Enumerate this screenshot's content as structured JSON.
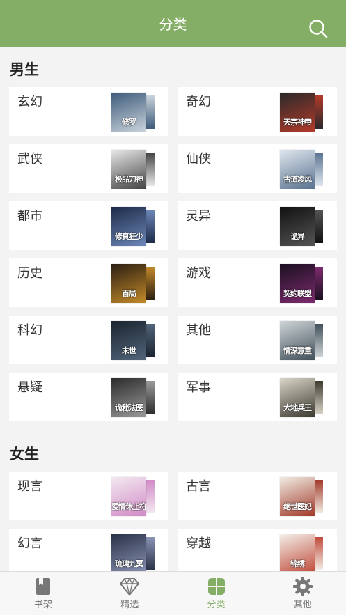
{
  "header": {
    "title": "分类",
    "search_icon": "search-icon"
  },
  "sections": [
    {
      "title": "男生",
      "items": [
        {
          "label": "玄幻",
          "cover_text": "修罗",
          "colors": [
            "#3e5b7a",
            "#c9d3dc"
          ]
        },
        {
          "label": "奇幻",
          "cover_text": "天宗神帝",
          "colors": [
            "#2a2a2a",
            "#b33a2a"
          ]
        },
        {
          "label": "武侠",
          "cover_text": "极品刀神",
          "colors": [
            "#e8e8e8",
            "#444444"
          ]
        },
        {
          "label": "仙侠",
          "cover_text": "古道凌风",
          "colors": [
            "#dfe6ee",
            "#5a7390"
          ]
        },
        {
          "label": "都市",
          "cover_text": "修真狂少",
          "colors": [
            "#1d2b48",
            "#6d87b8"
          ]
        },
        {
          "label": "灵异",
          "cover_text": "诡异",
          "colors": [
            "#111111",
            "#555555"
          ]
        },
        {
          "label": "历史",
          "cover_text": "百局",
          "colors": [
            "#2b1f12",
            "#c48a2a"
          ]
        },
        {
          "label": "游戏",
          "cover_text": "契约联盟",
          "colors": [
            "#1a1020",
            "#7d2b6e"
          ]
        },
        {
          "label": "科幻",
          "cover_text": "末世",
          "colors": [
            "#1b2430",
            "#52657a"
          ]
        },
        {
          "label": "其他",
          "cover_text": "情深意重",
          "colors": [
            "#cfd5d8",
            "#42505a"
          ]
        },
        {
          "label": "悬疑",
          "cover_text": "诡秘法医",
          "colors": [
            "#2c2c2c",
            "#9a9a9a"
          ]
        },
        {
          "label": "军事",
          "cover_text": "大地兵王",
          "colors": [
            "#d9d5c8",
            "#3d3a30"
          ]
        }
      ]
    },
    {
      "title": "女生",
      "items": [
        {
          "label": "现言",
          "cover_text": "爱情休止符",
          "colors": [
            "#f3e9f0",
            "#d18ac7"
          ]
        },
        {
          "label": "古言",
          "cover_text": "绝世医妃",
          "colors": [
            "#f1ede4",
            "#a23a2a"
          ]
        },
        {
          "label": "幻言",
          "cover_text": "琉璃九冥",
          "colors": [
            "#2a3247",
            "#8a94b5"
          ]
        },
        {
          "label": "穿越",
          "cover_text": "锦绣",
          "colors": [
            "#f3efe8",
            "#c04a3a"
          ]
        }
      ]
    }
  ],
  "tabbar": [
    {
      "label": "书架",
      "icon": "book-icon",
      "active": false
    },
    {
      "label": "精选",
      "icon": "diamond-icon",
      "active": false
    },
    {
      "label": "分类",
      "icon": "grid-clover-icon",
      "active": true
    },
    {
      "label": "其他",
      "icon": "gear-icon",
      "active": false
    }
  ],
  "colors": {
    "accent": "#84ad66",
    "inactive": "#777777"
  }
}
